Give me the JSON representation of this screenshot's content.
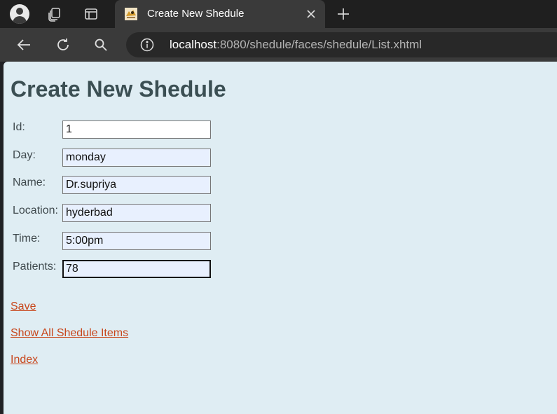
{
  "browser": {
    "tab_title": "Create New Shedule",
    "url_host": "localhost",
    "url_path": ":8080/shedule/faces/shedule/List.xhtml"
  },
  "page": {
    "heading": "Create New Shedule",
    "fields": [
      {
        "label": "Id:",
        "value": "1"
      },
      {
        "label": "Day:",
        "value": "monday"
      },
      {
        "label": "Name:",
        "value": "Dr.supriya"
      },
      {
        "label": "Location:",
        "value": "hyderbad"
      },
      {
        "label": "Time:",
        "value": "5:00pm"
      },
      {
        "label": "Patients:",
        "value": "78"
      }
    ],
    "links": {
      "save": "Save",
      "show_all": "Show All Shedule Items",
      "index": "Index"
    }
  },
  "colors": {
    "page_background": "#dfedf3",
    "heading": "#3b4f53",
    "link": "#c8461b",
    "autofill_field": "#e8f0fe"
  }
}
